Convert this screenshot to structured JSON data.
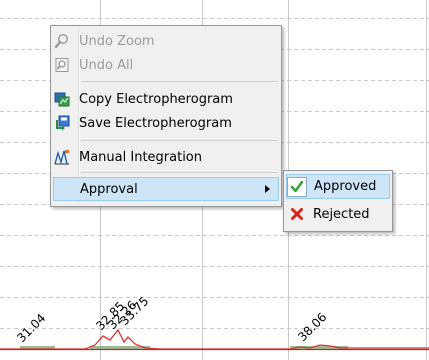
{
  "chart": {
    "peak_labels": [
      "31.04",
      "32.85",
      "32.26",
      "33.75",
      "38.06"
    ],
    "trace_color": "#e03030",
    "baseline_color": "#d02020",
    "grid_color": "#c8c8c8"
  },
  "context_menu": {
    "items": [
      {
        "label": "Undo Zoom",
        "icon": "zoom-icon",
        "enabled": false
      },
      {
        "label": "Undo All",
        "icon": "undo-all-icon",
        "enabled": false
      },
      {
        "label": "Copy Electropherogram",
        "icon": "copy-chart-icon",
        "enabled": true
      },
      {
        "label": "Save Electropherogram",
        "icon": "save-chart-icon",
        "enabled": true
      },
      {
        "label": "Manual Integration",
        "icon": "integration-icon",
        "enabled": true
      },
      {
        "label": "Approval",
        "icon": "",
        "enabled": true,
        "highlighted": true,
        "has_submenu": true
      }
    ]
  },
  "submenu": {
    "items": [
      {
        "label": "Approved",
        "icon": "check-icon",
        "highlighted": true,
        "accent": "#2da12d"
      },
      {
        "label": "Rejected",
        "icon": "x-icon",
        "accent": "#d8221c"
      }
    ]
  }
}
